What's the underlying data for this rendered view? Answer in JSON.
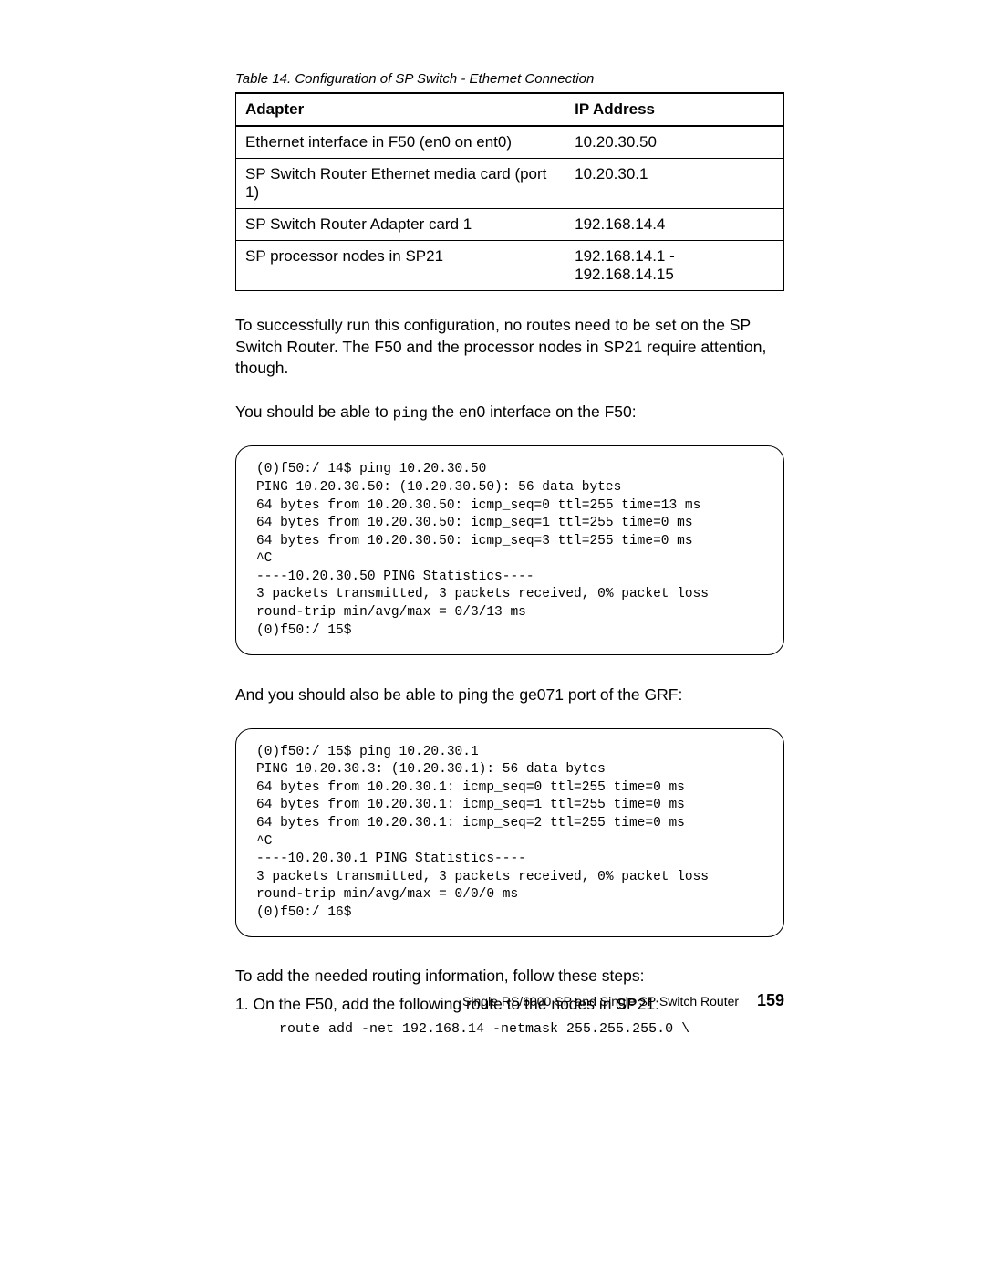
{
  "table": {
    "caption": "Table 14.  Configuration of SP Switch - Ethernet Connection",
    "headers": [
      "Adapter",
      "IP Address"
    ],
    "rows": [
      [
        "Ethernet interface in F50 (en0 on ent0)",
        "10.20.30.50"
      ],
      [
        "SP Switch Router Ethernet media card (port 1)",
        "10.20.30.1"
      ],
      [
        "SP Switch Router Adapter card 1",
        "192.168.14.4"
      ],
      [
        "SP processor nodes in SP21",
        "192.168.14.1 - 192.168.14.15"
      ]
    ]
  },
  "para1": "To successfully run this configuration, no routes need to be set on the SP Switch Router. The F50 and the processor nodes in SP21 require attention, though.",
  "para2_pre": "You should be able to ",
  "para2_mono": "ping",
  "para2_post": " the en0 interface on the F50:",
  "terminal1": "(0)f50:/ 14$ ping 10.20.30.50\nPING 10.20.30.50: (10.20.30.50): 56 data bytes\n64 bytes from 10.20.30.50: icmp_seq=0 ttl=255 time=13 ms\n64 bytes from 10.20.30.50: icmp_seq=1 ttl=255 time=0 ms\n64 bytes from 10.20.30.50: icmp_seq=3 ttl=255 time=0 ms\n^C\n----10.20.30.50 PING Statistics----\n3 packets transmitted, 3 packets received, 0% packet loss\nround-trip min/avg/max = 0/3/13 ms\n(0)f50:/ 15$",
  "para3": "And you should also be able to ping the ge071 port of the GRF:",
  "terminal2": "(0)f50:/ 15$ ping 10.20.30.1\nPING 10.20.30.3: (10.20.30.1): 56 data bytes\n64 bytes from 10.20.30.1: icmp_seq=0 ttl=255 time=0 ms\n64 bytes from 10.20.30.1: icmp_seq=1 ttl=255 time=0 ms\n64 bytes from 10.20.30.1: icmp_seq=2 ttl=255 time=0 ms\n^C\n----10.20.30.1 PING Statistics----\n3 packets transmitted, 3 packets received, 0% packet loss\nround-trip min/avg/max = 0/0/0 ms\n(0)f50:/ 16$",
  "steps_intro": "To add the needed routing information, follow these steps:",
  "step1": "1.  On the F50, add the following route to the nodes in SP21:",
  "route_cmd": "route add -net 192.168.14 -netmask 255.255.255.0 \\",
  "footer_text": "Single RS/6000 SP and Single SP Switch Router",
  "page_num": "159"
}
